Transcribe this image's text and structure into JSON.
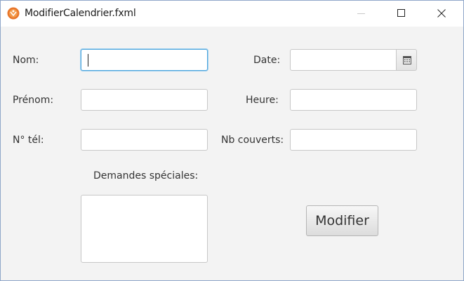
{
  "window": {
    "title": "ModifierCalendrier.fxml"
  },
  "form": {
    "nom_label": "Nom:",
    "nom_value": "",
    "prenom_label": "Prénom:",
    "prenom_value": "",
    "tel_label": "N° tél:",
    "tel_value": "",
    "demandes_label": "Demandes spéciales:",
    "demandes_value": "",
    "date_label": "Date:",
    "date_value": "",
    "heure_label": "Heure:",
    "heure_value": "",
    "couverts_label": "Nb couverts:",
    "couverts_value": "",
    "submit_label": "Modifier"
  },
  "icons": {
    "app": "app-logo-icon",
    "minimize": "minimize-icon",
    "maximize": "maximize-icon",
    "close": "close-icon",
    "date_picker": "calendar-icon"
  },
  "colors": {
    "focus_border": "#4ea5dd",
    "window_bg": "#f3f3f3",
    "app_icon": "#e8762b"
  }
}
